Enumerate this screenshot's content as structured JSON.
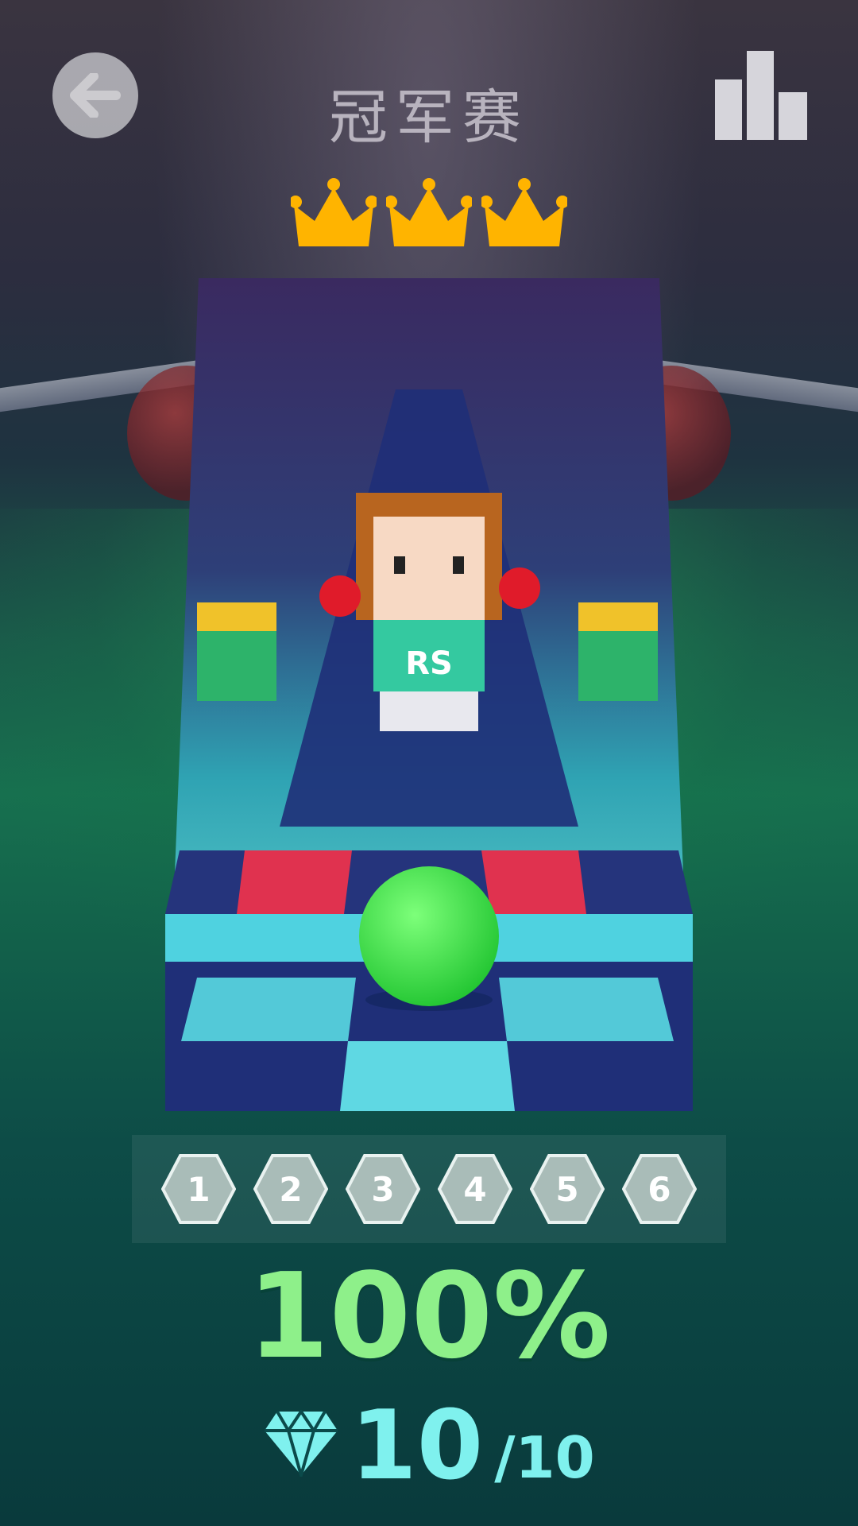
{
  "header": {
    "title": "冠军赛",
    "back_icon": "arrow-left-icon",
    "leaderboard_icon": "bar-chart-icon"
  },
  "stars": {
    "earned": 3,
    "total": 3,
    "icon": "crown-icon",
    "color": "#ffb400"
  },
  "preview": {
    "jersey_text": "RS",
    "player_ball_color": "#35d94a"
  },
  "levels": [
    "1",
    "2",
    "3",
    "4",
    "5",
    "6"
  ],
  "progress": {
    "percent_label": "100%"
  },
  "gems": {
    "collected": "10",
    "total": "/10",
    "icon": "diamond-icon"
  }
}
